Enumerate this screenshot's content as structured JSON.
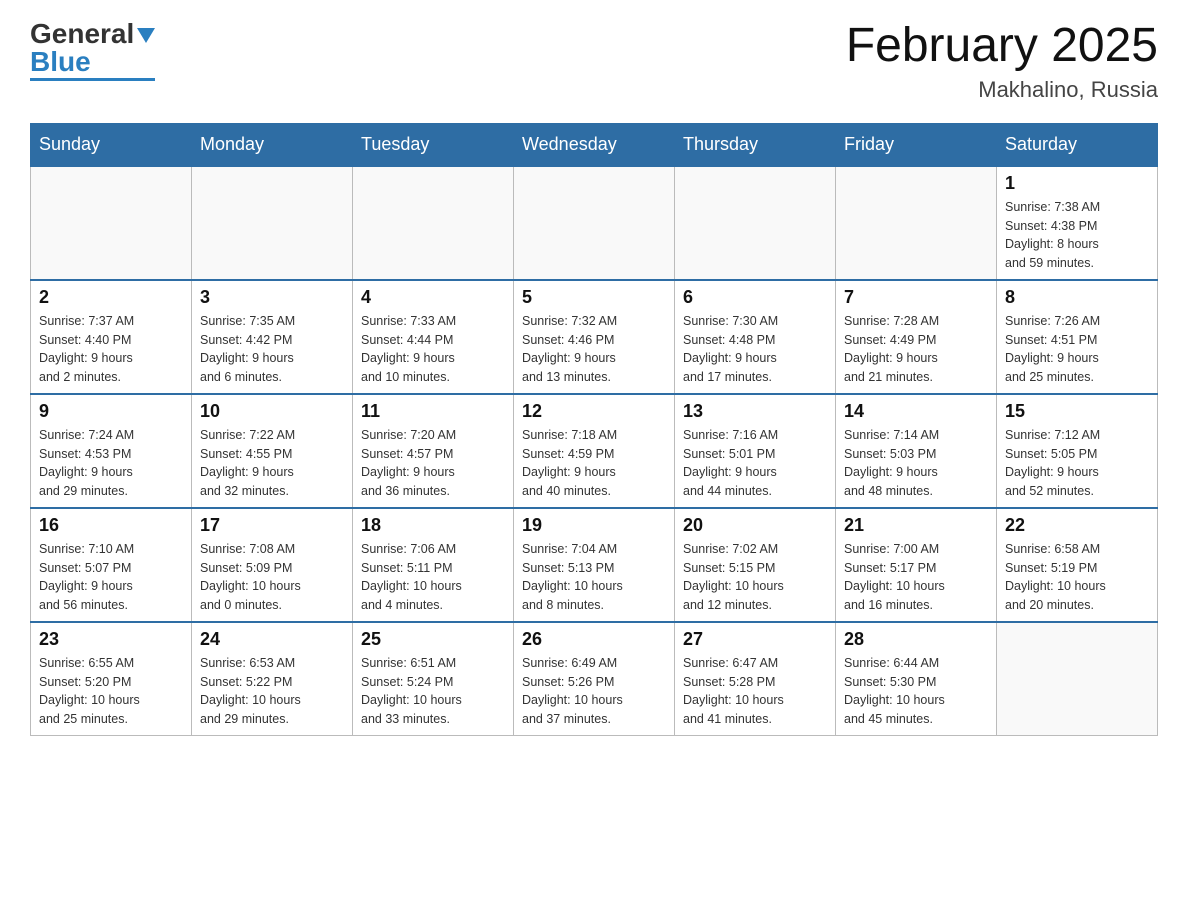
{
  "header": {
    "logo_general": "General",
    "logo_blue": "Blue",
    "month_title": "February 2025",
    "location": "Makhalino, Russia"
  },
  "days_of_week": [
    "Sunday",
    "Monday",
    "Tuesday",
    "Wednesday",
    "Thursday",
    "Friday",
    "Saturday"
  ],
  "weeks": [
    [
      {
        "day": "",
        "info": ""
      },
      {
        "day": "",
        "info": ""
      },
      {
        "day": "",
        "info": ""
      },
      {
        "day": "",
        "info": ""
      },
      {
        "day": "",
        "info": ""
      },
      {
        "day": "",
        "info": ""
      },
      {
        "day": "1",
        "info": "Sunrise: 7:38 AM\nSunset: 4:38 PM\nDaylight: 8 hours\nand 59 minutes."
      }
    ],
    [
      {
        "day": "2",
        "info": "Sunrise: 7:37 AM\nSunset: 4:40 PM\nDaylight: 9 hours\nand 2 minutes."
      },
      {
        "day": "3",
        "info": "Sunrise: 7:35 AM\nSunset: 4:42 PM\nDaylight: 9 hours\nand 6 minutes."
      },
      {
        "day": "4",
        "info": "Sunrise: 7:33 AM\nSunset: 4:44 PM\nDaylight: 9 hours\nand 10 minutes."
      },
      {
        "day": "5",
        "info": "Sunrise: 7:32 AM\nSunset: 4:46 PM\nDaylight: 9 hours\nand 13 minutes."
      },
      {
        "day": "6",
        "info": "Sunrise: 7:30 AM\nSunset: 4:48 PM\nDaylight: 9 hours\nand 17 minutes."
      },
      {
        "day": "7",
        "info": "Sunrise: 7:28 AM\nSunset: 4:49 PM\nDaylight: 9 hours\nand 21 minutes."
      },
      {
        "day": "8",
        "info": "Sunrise: 7:26 AM\nSunset: 4:51 PM\nDaylight: 9 hours\nand 25 minutes."
      }
    ],
    [
      {
        "day": "9",
        "info": "Sunrise: 7:24 AM\nSunset: 4:53 PM\nDaylight: 9 hours\nand 29 minutes."
      },
      {
        "day": "10",
        "info": "Sunrise: 7:22 AM\nSunset: 4:55 PM\nDaylight: 9 hours\nand 32 minutes."
      },
      {
        "day": "11",
        "info": "Sunrise: 7:20 AM\nSunset: 4:57 PM\nDaylight: 9 hours\nand 36 minutes."
      },
      {
        "day": "12",
        "info": "Sunrise: 7:18 AM\nSunset: 4:59 PM\nDaylight: 9 hours\nand 40 minutes."
      },
      {
        "day": "13",
        "info": "Sunrise: 7:16 AM\nSunset: 5:01 PM\nDaylight: 9 hours\nand 44 minutes."
      },
      {
        "day": "14",
        "info": "Sunrise: 7:14 AM\nSunset: 5:03 PM\nDaylight: 9 hours\nand 48 minutes."
      },
      {
        "day": "15",
        "info": "Sunrise: 7:12 AM\nSunset: 5:05 PM\nDaylight: 9 hours\nand 52 minutes."
      }
    ],
    [
      {
        "day": "16",
        "info": "Sunrise: 7:10 AM\nSunset: 5:07 PM\nDaylight: 9 hours\nand 56 minutes."
      },
      {
        "day": "17",
        "info": "Sunrise: 7:08 AM\nSunset: 5:09 PM\nDaylight: 10 hours\nand 0 minutes."
      },
      {
        "day": "18",
        "info": "Sunrise: 7:06 AM\nSunset: 5:11 PM\nDaylight: 10 hours\nand 4 minutes."
      },
      {
        "day": "19",
        "info": "Sunrise: 7:04 AM\nSunset: 5:13 PM\nDaylight: 10 hours\nand 8 minutes."
      },
      {
        "day": "20",
        "info": "Sunrise: 7:02 AM\nSunset: 5:15 PM\nDaylight: 10 hours\nand 12 minutes."
      },
      {
        "day": "21",
        "info": "Sunrise: 7:00 AM\nSunset: 5:17 PM\nDaylight: 10 hours\nand 16 minutes."
      },
      {
        "day": "22",
        "info": "Sunrise: 6:58 AM\nSunset: 5:19 PM\nDaylight: 10 hours\nand 20 minutes."
      }
    ],
    [
      {
        "day": "23",
        "info": "Sunrise: 6:55 AM\nSunset: 5:20 PM\nDaylight: 10 hours\nand 25 minutes."
      },
      {
        "day": "24",
        "info": "Sunrise: 6:53 AM\nSunset: 5:22 PM\nDaylight: 10 hours\nand 29 minutes."
      },
      {
        "day": "25",
        "info": "Sunrise: 6:51 AM\nSunset: 5:24 PM\nDaylight: 10 hours\nand 33 minutes."
      },
      {
        "day": "26",
        "info": "Sunrise: 6:49 AM\nSunset: 5:26 PM\nDaylight: 10 hours\nand 37 minutes."
      },
      {
        "day": "27",
        "info": "Sunrise: 6:47 AM\nSunset: 5:28 PM\nDaylight: 10 hours\nand 41 minutes."
      },
      {
        "day": "28",
        "info": "Sunrise: 6:44 AM\nSunset: 5:30 PM\nDaylight: 10 hours\nand 45 minutes."
      },
      {
        "day": "",
        "info": ""
      }
    ]
  ]
}
